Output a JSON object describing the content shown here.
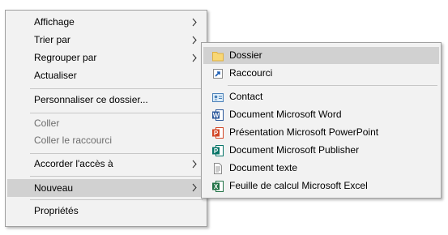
{
  "context_menu": {
    "items": [
      {
        "label": "Affichage"
      },
      {
        "label": "Trier par"
      },
      {
        "label": "Regrouper par"
      },
      {
        "label": "Actualiser"
      },
      {
        "label": "Personnaliser ce dossier..."
      },
      {
        "label": "Coller"
      },
      {
        "label": "Coller le raccourci"
      },
      {
        "label": "Accorder l'accès à"
      },
      {
        "label": "Nouveau"
      },
      {
        "label": "Propriétés"
      }
    ]
  },
  "submenu_nouveau": {
    "items": [
      {
        "label": "Dossier",
        "icon": "folder-icon"
      },
      {
        "label": "Raccourci",
        "icon": "shortcut-icon"
      },
      {
        "label": "Contact",
        "icon": "contact-icon"
      },
      {
        "label": "Document Microsoft Word",
        "icon": "word-icon"
      },
      {
        "label": "Présentation Microsoft PowerPoint",
        "icon": "powerpoint-icon"
      },
      {
        "label": "Document Microsoft Publisher",
        "icon": "publisher-icon"
      },
      {
        "label": "Document texte",
        "icon": "text-document-icon"
      },
      {
        "label": "Feuille de calcul Microsoft Excel",
        "icon": "excel-icon"
      }
    ]
  },
  "colors": {
    "menu_background": "#f2f2f2",
    "highlight": "#d1d1d1",
    "disabled_text": "#6d6d6d",
    "word_blue": "#2b579a",
    "powerpoint_orange": "#d24726",
    "publisher_teal": "#077568",
    "excel_green": "#217346",
    "folder_yellow": "#f8d775"
  }
}
